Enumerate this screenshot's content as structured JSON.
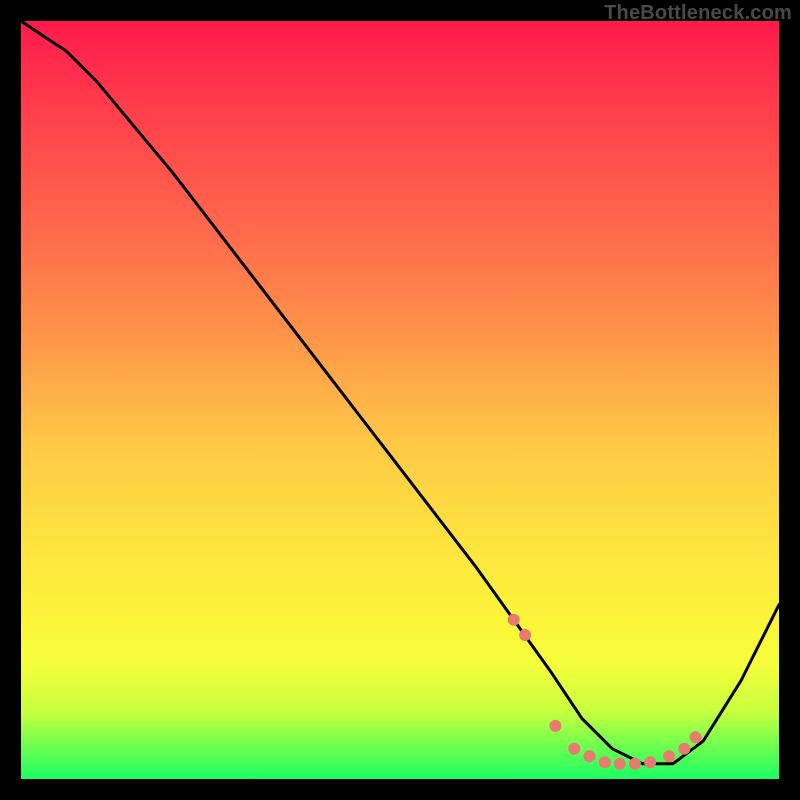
{
  "watermark": "TheBottleneck.com",
  "chart_data": {
    "type": "line",
    "title": "",
    "xlabel": "",
    "ylabel": "",
    "xlim": [
      0,
      100
    ],
    "ylim": [
      0,
      100
    ],
    "grid": false,
    "legend": "none",
    "series": [
      {
        "name": "curve",
        "stroke": "#000000",
        "x": [
          0,
          3,
          6,
          10,
          15,
          20,
          30,
          40,
          50,
          60,
          65,
          70,
          74,
          78,
          82,
          86,
          90,
          95,
          100
        ],
        "values": [
          100,
          98,
          96,
          92,
          86,
          80,
          67,
          54,
          41,
          28,
          21,
          14,
          8,
          4,
          2,
          2,
          5,
          13,
          23
        ]
      }
    ],
    "markers": {
      "name": "highlight-dots",
      "color": "#e97a70",
      "radius": 6,
      "x": [
        65.0,
        66.5,
        70.5,
        73.0,
        75.0,
        77.0,
        79.0,
        81.0,
        83.0,
        85.5,
        87.5,
        89.0
      ],
      "values": [
        21.0,
        19.0,
        7.0,
        4.0,
        3.0,
        2.2,
        2.0,
        2.0,
        2.2,
        3.0,
        4.0,
        5.5
      ]
    }
  }
}
